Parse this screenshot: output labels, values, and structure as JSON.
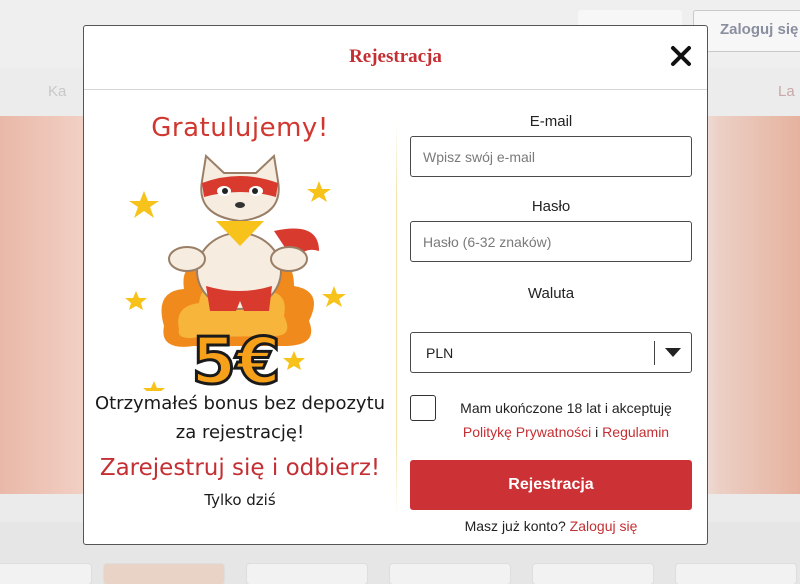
{
  "background": {
    "header_login_label": "Zaloguj się",
    "nav_left_label": "Ka",
    "nav_right_label": "La"
  },
  "modal": {
    "title": "Rejestracja",
    "close_icon": "close-icon"
  },
  "promo": {
    "headline": "Gratulujemy!",
    "bonus_amount": "5€",
    "line1": "Otrzymałeś bonus bez depozytu",
    "line2": "za rejestrację!",
    "cta": "Zarejestruj się i odbierz!",
    "small": "Tylko dziś",
    "accent_color": "#c42f33"
  },
  "form": {
    "email_label": "E-mail",
    "email_placeholder": "Wpisz swój e-mail",
    "password_label": "Hasło",
    "password_placeholder": "Hasło (6-32 znaków)",
    "currency_label": "Waluta",
    "currency_value": "PLN",
    "consent_text": "Mam ukończone 18 lat i akceptuję",
    "privacy_link": "Politykę Prywatności",
    "consent_and": "i",
    "terms_link": "Regulamin",
    "submit_label": "Rejestracja",
    "have_account_text": "Masz już konto?",
    "login_link": "Zaloguj się",
    "button_color": "#cc3135"
  }
}
